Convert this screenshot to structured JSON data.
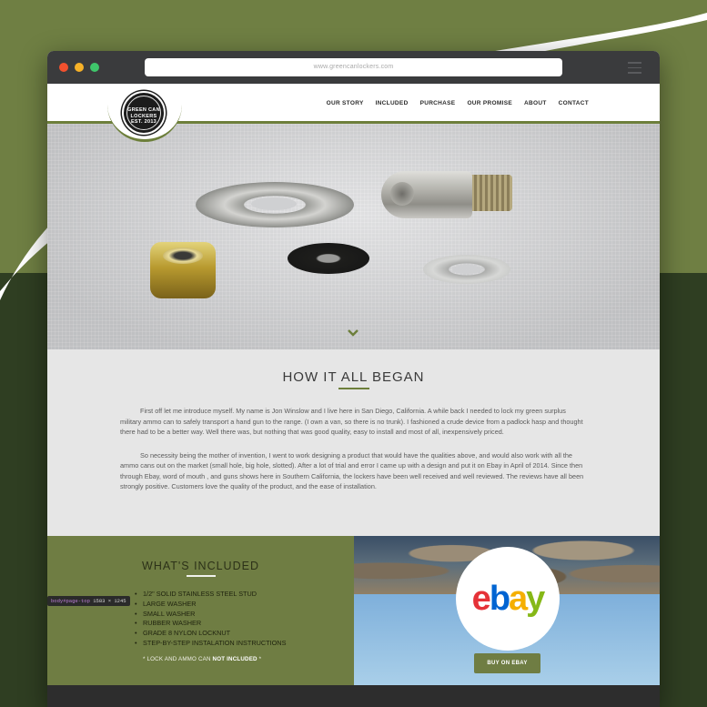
{
  "browser": {
    "url": "www.greencanlockers.com"
  },
  "header": {
    "logo": {
      "line1": "GREEN CAN",
      "line2": "LOCKERS",
      "line3": "EST. 2013"
    },
    "nav": [
      "OUR STORY",
      "INCLUDED",
      "PURCHASE",
      "OUR PROMISE",
      "ABOUT",
      "CONTACT"
    ]
  },
  "about": {
    "title": "HOW IT ALL BEGAN",
    "paragraph1": "First off let me introduce myself. My name is Jon Winslow and I live here in San Diego, California. A while back I needed to lock my green surplus military ammo can to safely transport a hand gun to the range. (I own a van, so there is no trunk). I fashioned a crude device from a padlock hasp and thought there had to be a better way. Well there was, but nothing that was good quality, easy to install and most of all, inexpensively priced.",
    "paragraph2": "So necessity being the mother of invention, I went to work designing a product that would have the qualities above, and would also work with all the ammo cans out on the market (small hole, big hole, slotted). After a lot of trial and error I came up with a design and put it on Ebay in April of 2014. Since then through Ebay, word of mouth , and guns shows here in Southern California, the lockers have been well received and well reviewed. The reviews have all been strongly positive. Customers love the quality of the product, and the ease of installation."
  },
  "included": {
    "title": "WHAT'S INCLUDED",
    "items": [
      "1/2\" SOLID STAINLESS STEEL STUD",
      "LARGE WASHER",
      "SMALL WASHER",
      "RUBBER WASHER",
      "GRADE 8 NYLON LOCKNUT",
      "STEP-BY-STEP INSTALATION INSTRUCTIONS"
    ],
    "note_prefix": "* LOCK AND AMMO CAN ",
    "note_bold": "NOT INCLUDED",
    "note_suffix": " *"
  },
  "devtools_tag": {
    "selector": "body#page-top",
    "size": "1583 × 1245"
  },
  "ebay": {
    "logo_letters": [
      "e",
      "b",
      "a",
      "y"
    ],
    "button_label": "BUY ON EBAY"
  },
  "colors": {
    "brand_green": "#6f7d43",
    "background_dark": "#2f3e22"
  }
}
